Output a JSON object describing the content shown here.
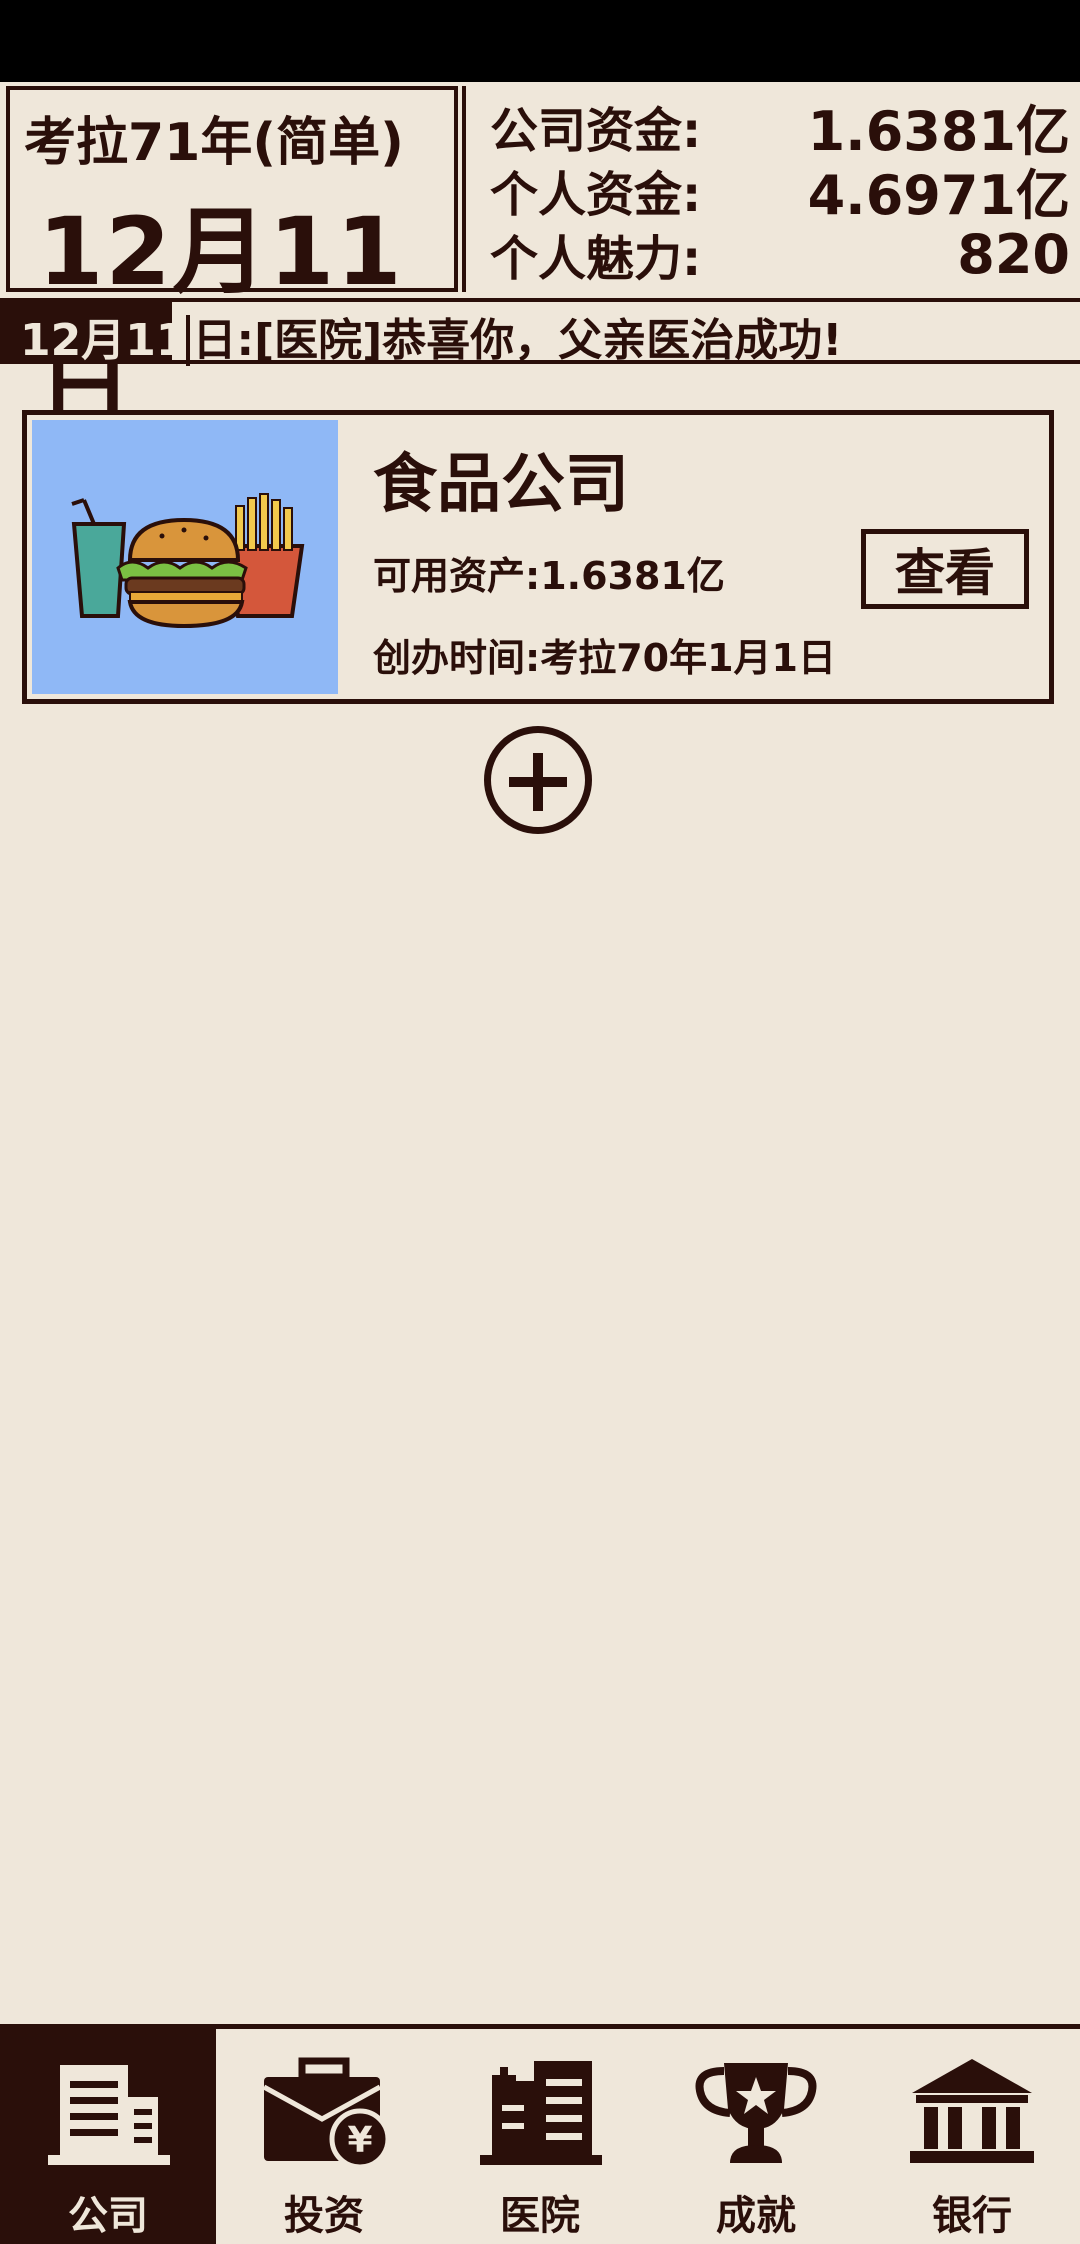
{
  "header": {
    "year_label": "考拉71年(简单)",
    "date": "12月11日",
    "stats": [
      {
        "label": "公司资金:",
        "value": "1.6381亿"
      },
      {
        "label": "个人资金:",
        "value": "4.6971亿"
      },
      {
        "label": "个人魅力:",
        "value": "820"
      }
    ]
  },
  "ticker": {
    "date": "12月11",
    "message": "日:[医院]恭喜你，父亲医治成功!"
  },
  "company": {
    "name": "食品公司",
    "assets": "可用资产:1.6381亿",
    "founded": "创办时间:考拉70年1月1日",
    "view_label": "查看"
  },
  "nav": [
    {
      "label": "公司",
      "icon": "building-icon",
      "active": true
    },
    {
      "label": "投资",
      "icon": "briefcase-yen-icon",
      "active": false
    },
    {
      "label": "医院",
      "icon": "hospital-icon",
      "active": false
    },
    {
      "label": "成就",
      "icon": "trophy-icon",
      "active": false
    },
    {
      "label": "银行",
      "icon": "bank-icon",
      "active": false
    }
  ],
  "colors": {
    "background": "#efe7da",
    "ink": "#2a0f0a",
    "thumb_bg": "#8fb8f6"
  }
}
